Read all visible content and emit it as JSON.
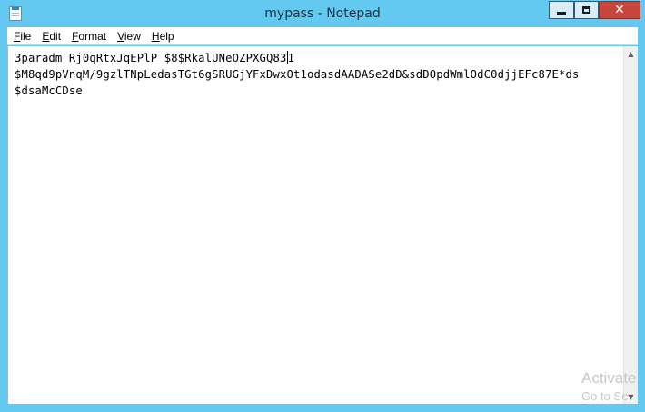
{
  "window": {
    "title": "mypass - Notepad",
    "icon": "notepad-icon",
    "controls": {
      "minimize_icon": "minimize-icon",
      "maximize_icon": "maximize-icon",
      "close_icon": "close-icon",
      "close_label": "✕"
    },
    "frame_color": "#63c9f0",
    "close_color": "#c7463b"
  },
  "menubar": {
    "items": [
      {
        "label_u": "F",
        "label_rest": "ile"
      },
      {
        "label_u": "E",
        "label_rest": "dit"
      },
      {
        "label_u": "F",
        "label_rest": "ormat"
      },
      {
        "label_u": "V",
        "label_rest": "iew"
      },
      {
        "label_u": "H",
        "label_rest": "elp"
      }
    ]
  },
  "editor": {
    "line1_before_caret": "3paradm Rj0qRtxJqEPlP $8$RkalUNeOZPXGQ83",
    "line1_after_caret": "1",
    "line2": "$M8qd9pVnqM/9gzlTNpLedasTGt6gSRUGjYFxDwxOt1odasdAADASe2dD&sdDOpdWmlOdC0djjEFc87E*ds",
    "line3": "$dsaMcCDse"
  },
  "scrollbar": {
    "up_arrow": "▲",
    "down_arrow": "▼"
  },
  "watermark": {
    "line1": "Activate",
    "line2": "Go to Se"
  }
}
